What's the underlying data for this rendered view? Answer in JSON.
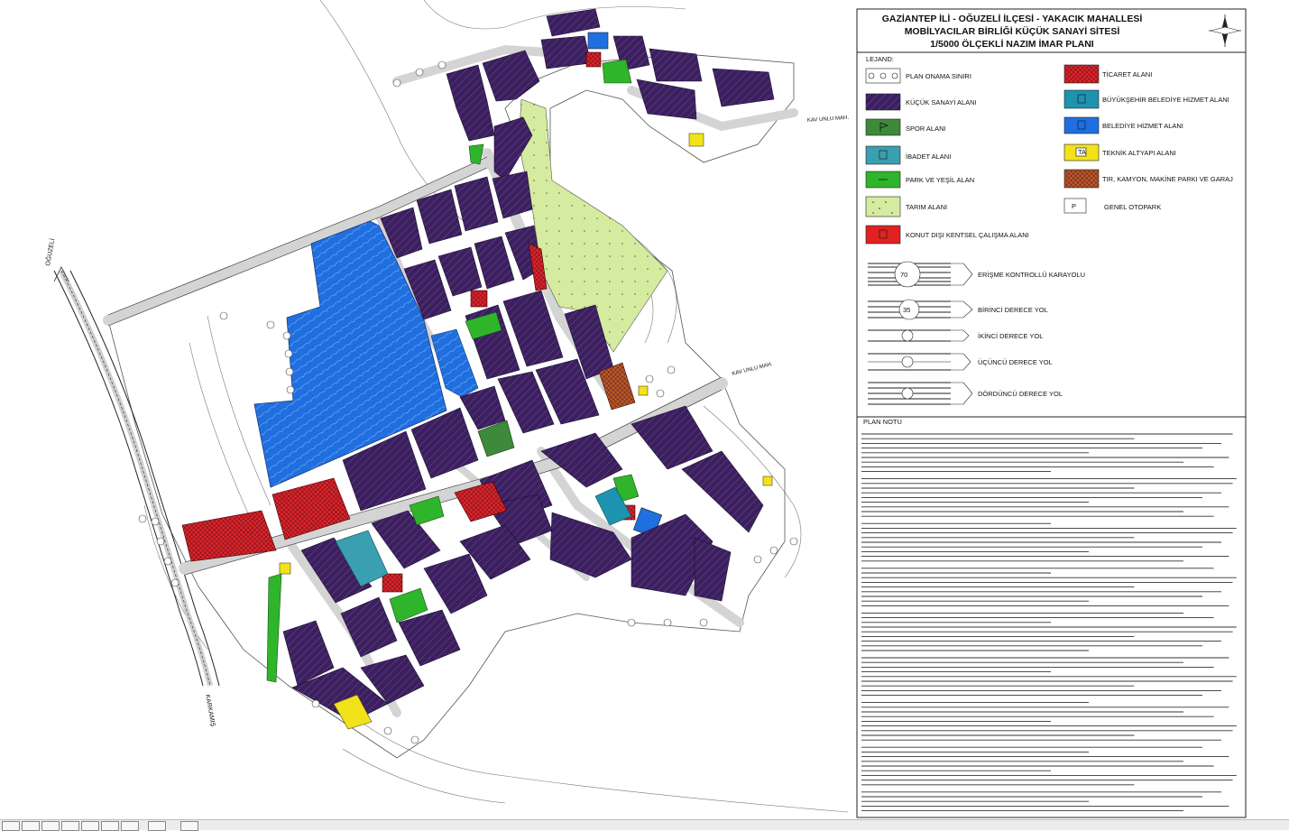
{
  "title": {
    "line1": "GAZİANTEP  İLİ - OĞUZELİ  İLÇESİ - YAKACIK  MAHALLESİ",
    "line2": "MOBİLYACILAR  BİRLİĞİ  KÜÇÜK  SANAYİ  SİTESİ",
    "line3": "1/5000  ÖLÇEKLİ  NAZIM   İMAR  PLANI"
  },
  "legend": {
    "heading": "LEJAND:",
    "items": [
      {
        "label": "PLAN ONAMA SINIRI",
        "color": "#ffffff",
        "symbol": "circle-chain"
      },
      {
        "label": "KÜÇÜK SANAYİ ALANI",
        "color": "#3b1f5e",
        "symbol": "hatch"
      },
      {
        "label": "SPOR ALANI",
        "color": "#3c8a3a",
        "symbol": "flag"
      },
      {
        "label": "İBADET ALANI",
        "color": "#3a9fb0",
        "symbol": "box"
      },
      {
        "label": "PARK VE YEŞİL ALAN",
        "color": "#2fb52a",
        "symbol": "dash"
      },
      {
        "label": "TARIM ALANI",
        "color": "#d5eca0",
        "symbol": "dots"
      },
      {
        "label": "KONUT DIŞI KENTSEL ÇALIŞMA ALANI",
        "color": "#e02222",
        "symbol": "box"
      },
      {
        "label": "TİCARET ALANI",
        "color": "#d8262e",
        "symbol": "grid"
      },
      {
        "label": "BÜYÜKŞEHİR BELEDİYE HİZMET ALANI",
        "color": "#1d93b0",
        "symbol": "box"
      },
      {
        "label": "BELEDİYE HİZMET ALANI",
        "color": "#1f6fe0",
        "symbol": "box"
      },
      {
        "label": "TEKNİK ALTYAPI ALANI",
        "color": "#f2e21a",
        "symbol": "TA"
      },
      {
        "label": "TIR, KAMYON, MAKİNE PARKI VE GARAJ",
        "color": "#8a3a22",
        "symbol": "grid"
      },
      {
        "label": "GENEL OTOPARK",
        "color": "#ffffff",
        "symbol": "P"
      }
    ],
    "roads": [
      {
        "label": "ERİŞME KONTROLLÜ KARAYOLU",
        "badge": "70"
      },
      {
        "label": "BİRİNCİ DERECE YOL",
        "badge": "35"
      },
      {
        "label": "İKİNCİ DERECE YOL",
        "badge": ""
      },
      {
        "label": "ÜÇÜNCÜ DERECE YOL",
        "badge": ""
      },
      {
        "label": "DÖRDÜNCÜ DERECE YOL",
        "badge": ""
      }
    ]
  },
  "plan_notes": {
    "heading": "PLAN NOTU"
  },
  "map_labels": {
    "oguzeli": "OĞUZELİ",
    "karkamis": "KARKAMIŞ",
    "kavunlu_top": "KAV UNLU MAH.",
    "kavunlu_mid": "KAV UNLU MAH."
  },
  "colors": {
    "industry": "#3b1f5e",
    "municipal_blue": "#1f6fe0",
    "commerce_red": "#d8262e",
    "green_park": "#2fb52a",
    "sport": "#3c8a3a",
    "worship": "#3a9fb0",
    "agriculture": "#d5eca0",
    "tech": "#f2e21a",
    "truck_park": "#8a3a22"
  }
}
